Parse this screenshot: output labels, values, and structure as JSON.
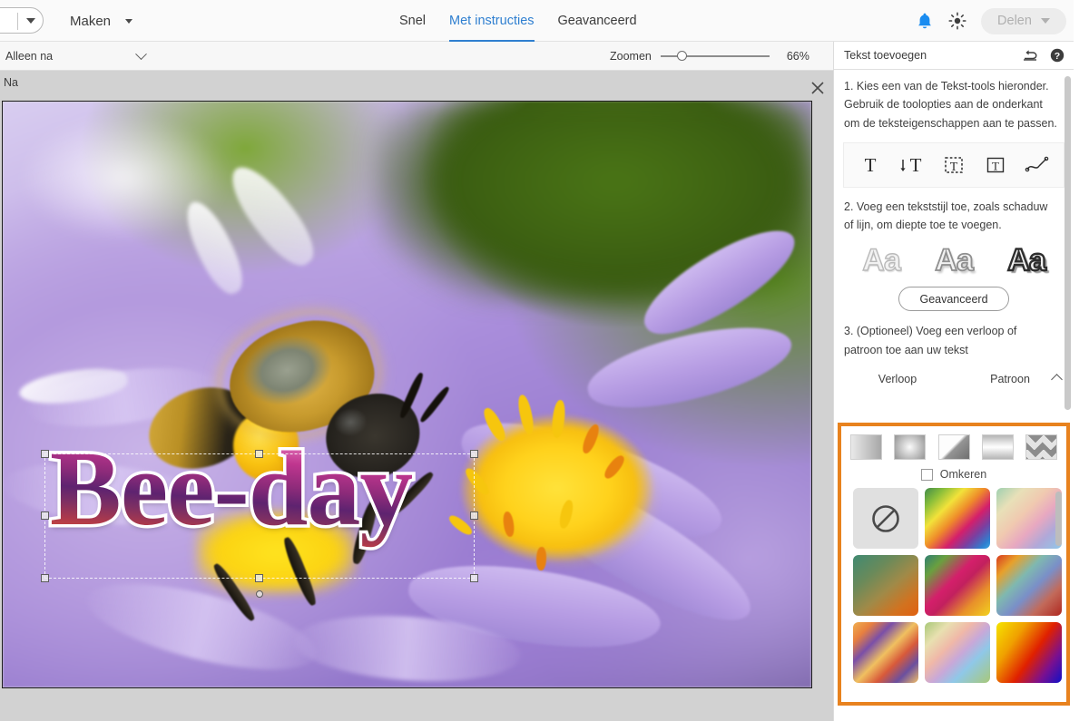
{
  "header": {
    "split_button": {
      "name": "tool-preset-split-button",
      "caret": "chevron-down-icon"
    },
    "menu_label": "Maken",
    "tabs": [
      {
        "label": "Snel",
        "active": false
      },
      {
        "label": "Met instructies",
        "active": true
      },
      {
        "label": "Geavanceerd",
        "active": false
      }
    ],
    "notifications_icon": "bell-icon",
    "brightness_icon": "sun-icon",
    "share_button_label": "Delen",
    "share_accent": "#b0b0b0",
    "active_tab_color": "#2f7fd0"
  },
  "options_bar": {
    "view_mode": "Alleen na",
    "zoom_label": "Zoomen",
    "zoom_percent": "66%",
    "zoom_value": 66
  },
  "canvas": {
    "view_label": "Na",
    "close_icon": "close-icon",
    "text_object": {
      "content": "Bee-day",
      "stroke_color": "#ffffff",
      "gradient": "pink-magenta-purple-red"
    },
    "photo_description": "honeybee on purple aster flower"
  },
  "panel": {
    "title": "Tekst toevoegen",
    "undo_icon": "undo-icon",
    "help_icon": "help-icon",
    "step1": "1. Kies een van de Tekst-tools hieronder. Gebruik de toolopties aan de onderkant om de teksteigenschappen aan te passen.",
    "text_tools": [
      {
        "name": "horizontal-text-tool",
        "glyph": "T"
      },
      {
        "name": "vertical-text-tool",
        "glyph": "↓T"
      },
      {
        "name": "text-mask-tool",
        "glyph": "[T]"
      },
      {
        "name": "text-box-tool",
        "glyph": "T"
      },
      {
        "name": "text-on-path-tool",
        "glyph": "path"
      }
    ],
    "step2": "2. Voeg een tekststijl toe, zoals schaduw of lijn, om diepte toe te voegen.",
    "style_previews": [
      {
        "name": "text-style-light",
        "label": "Aa"
      },
      {
        "name": "text-style-medium",
        "label": "Aa"
      },
      {
        "name": "text-style-heavy",
        "label": "Aa"
      }
    ],
    "advanced_button": "Geavanceerd",
    "step3": "3. (Optioneel) Voeg een verloop of patroon toe aan uw tekst",
    "sub_tabs": [
      {
        "label": "Verloop",
        "active": true
      },
      {
        "label": "Patroon",
        "active": false
      }
    ],
    "collapse_icon": "chevron-up-icon",
    "highlight_color": "#e8821e",
    "gradient": {
      "types": [
        {
          "name": "gradient-type-linear",
          "class": "linear"
        },
        {
          "name": "gradient-type-radial",
          "class": "radial"
        },
        {
          "name": "gradient-type-angle",
          "class": "angle"
        },
        {
          "name": "gradient-type-reflected",
          "class": "reflect"
        },
        {
          "name": "gradient-type-diamond",
          "class": "diamond"
        }
      ],
      "reverse_label": "Omkeren",
      "reverse_checked": false,
      "swatches": [
        {
          "name": "gradient-swatch-none",
          "none": true
        },
        {
          "name": "gradient-swatch-1",
          "css": "linear-gradient(135deg,#3f8a4a 0%,#8bbf3a 16%,#f2e23a 32%,#ef8b2a 48%,#d41f6b 64%,#7a3fa0 78%,#2f7fd0 92%,#3aa7e0 100%)"
        },
        {
          "name": "gradient-swatch-2",
          "css": "linear-gradient(135deg,#9fd0b0 0%,#e8e0b8 22%,#f0c9b0 42%,#e8a8c0 60%,#b0a8d8 78%,#8fc8e8 100%)"
        },
        {
          "name": "gradient-swatch-3",
          "css": "linear-gradient(140deg,#3f8a72 0%,#6a8a5a 30%,#a08a48 55%,#d2721f 80%,#e06010 100%)"
        },
        {
          "name": "gradient-swatch-4",
          "css": "linear-gradient(135deg,#2f7f72 0%,#6aa03f 18%,#d41f6b 42%,#c2205e 54%,#e8902a 76%,#f2d21f 100%)"
        },
        {
          "name": "gradient-swatch-5",
          "css": "linear-gradient(135deg,#d83a1f 0%,#e8a02a 18%,#7fb8b0 38%,#7a8fc8 56%,#c26a5a 76%,#b02820 100%)"
        },
        {
          "name": "gradient-swatch-6",
          "css": "linear-gradient(135deg,#f0b050 0%,#e8803f 16%,#7a4fa8 32%,#f0c060 50%,#d85a3a 66%,#6a4f9f 82%,#f2bf68 100%)"
        },
        {
          "name": "gradient-swatch-7",
          "css": "linear-gradient(135deg,#a8c878 0%,#e8e0b0 20%,#f0b8a8 38%,#c8a8d8 54%,#8fc8e8 70%,#a8c878 100%)"
        },
        {
          "name": "gradient-swatch-8",
          "css": "linear-gradient(125deg,#f5e400 0%,#f0a000 28%,#e02000 55%,#7a1090 78%,#1010c8 100%)"
        }
      ]
    }
  }
}
